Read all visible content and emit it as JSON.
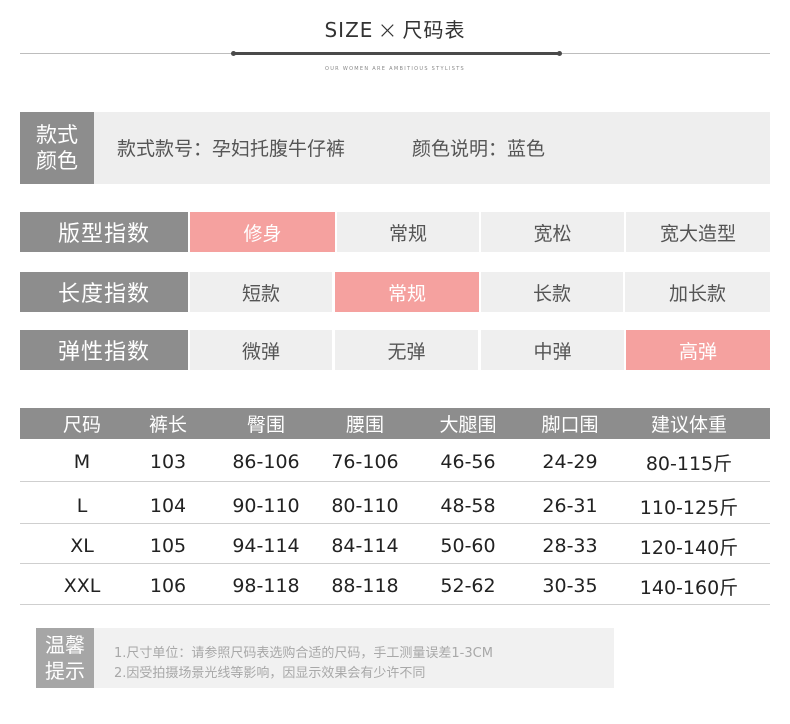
{
  "header": {
    "title_en": "SIZE",
    "title_sep": "×",
    "title_cn": "尺码表",
    "tagline": "OUR WOMEN ARE AMBITIOUS STYLISTS"
  },
  "style": {
    "label_line1": "款式",
    "label_line2": "颜色",
    "model": "款式款号：孕妇托腹牛仔裤",
    "color": "颜色说明：蓝色"
  },
  "indices": [
    {
      "label": "版型指数",
      "options": [
        "修身",
        "常规",
        "宽松",
        "宽大造型"
      ],
      "selected": 0
    },
    {
      "label": "长度指数",
      "options": [
        "短款",
        "常规",
        "长款",
        "加长款"
      ],
      "selected": 1
    },
    {
      "label": "弹性指数",
      "options": [
        "微弹",
        "无弹",
        "中弹",
        "高弹"
      ],
      "selected": 3
    }
  ],
  "size_table": {
    "headers": [
      "尺码",
      "裤长",
      "臀围",
      "腰围",
      "大腿围",
      "脚口围",
      "建议体重"
    ],
    "rows": [
      [
        "M",
        "103",
        "86-106",
        "76-106",
        "46-56",
        "24-29",
        "80-115斤"
      ],
      [
        "L",
        "104",
        "90-110",
        "80-110",
        "48-58",
        "26-31",
        "110-125斤"
      ],
      [
        "XL",
        "105",
        "94-114",
        "84-114",
        "50-60",
        "28-33",
        "120-140斤"
      ],
      [
        "XXL",
        "106",
        "98-118",
        "88-118",
        "52-62",
        "30-35",
        "140-160斤"
      ]
    ]
  },
  "tips": {
    "label_line1": "温馨",
    "label_line2": "提示",
    "lines": [
      "1.尺寸单位：请参照尺码表选购合适的尺码，手工测量误差1-3CM",
      "2.因受拍摄场景光线等影响，因显示效果会有少许不同"
    ]
  },
  "colors": {
    "label_gray": "#8d8d8d",
    "cell_gray": "#efefef",
    "highlight_pink": "#f5a19f"
  }
}
